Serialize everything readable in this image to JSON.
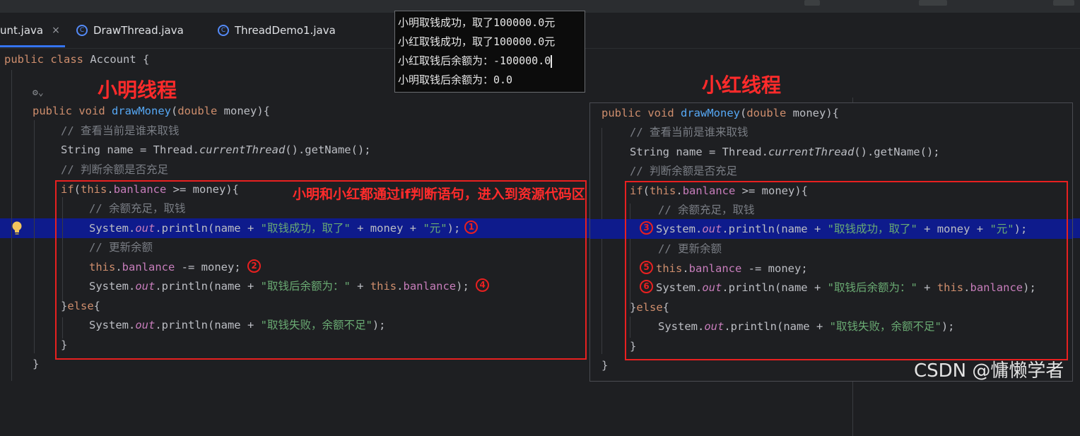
{
  "tabs": [
    {
      "label": "unt.java",
      "close": "×",
      "active": true
    },
    {
      "label": "DrawThread.java",
      "active": false
    },
    {
      "label": "ThreadDemo1.java",
      "active": false
    }
  ],
  "code": {
    "class_line": {
      "kw": "public class",
      "name": "Account",
      "brace": "{"
    },
    "left": {
      "method_kw": "public void",
      "method_name": "drawMoney",
      "param_open": "(",
      "param_type": "double",
      "param_rest": " money){",
      "cmt1": "// 查看当前是谁来取钱",
      "name_a": "String name = Thread.",
      "name_b": "currentThread",
      "name_c": "().getName();",
      "cmt2": "// 判断余额是否充足",
      "if_kw": "if",
      "if_open": "(",
      "this1": "this",
      "dot1": ".",
      "fld1": "banlance",
      "if_rest": " >= money){",
      "cmt3": "// 余额充足，取钱",
      "p1_a": "System.",
      "p1_out": "out",
      "p1_b": ".println(name + ",
      "p1_str1": "\"取钱成功，取了\"",
      "p1_c": " + money + ",
      "p1_str2": "\"元\"",
      "p1_d": ");",
      "cmt4": "// 更新余额",
      "sub_this": "this",
      "sub_dot": ".",
      "sub_fld": "banlance",
      "sub_rest": " -= money;",
      "p2_a": "System.",
      "p2_out": "out",
      "p2_b": ".println(name + ",
      "p2_str": "\"取钱后余额为：\"",
      "p2_c": " + ",
      "p2_this": "this",
      "p2_dot": ".",
      "p2_fld": "banlance",
      "p2_d": ");",
      "else_a": "}",
      "else_kw": "else",
      "else_b": "{",
      "p3_a": "System.",
      "p3_out": "out",
      "p3_b": ".println(name + ",
      "p3_str": "\"取钱失败，余额不足\"",
      "p3_c": ");",
      "close_if": "}",
      "close_method": "}"
    }
  },
  "annotations": {
    "left_title": "小明线程",
    "right_title": "小红线程",
    "middle_note": "小明和小红都通过if判断语句，进入到资源代码区",
    "step1": "1",
    "step2": "2",
    "step3": "3",
    "step4": "4",
    "step5": "5",
    "step6": "6"
  },
  "console": {
    "lines": [
      "小明取钱成功，取了100000.0元",
      "小红取钱成功，取了100000.0元",
      "小红取钱后余额为：-100000.0",
      "小明取钱后余额为：0.0"
    ]
  },
  "inlay_hint": "⚙⌄",
  "watermark": "CSDN @慵懒学者",
  "colors": {
    "keyword": "#cf8e6d",
    "function": "#56a8f5",
    "field": "#c77dbb",
    "string": "#6aab73",
    "comment": "#7a7e85",
    "highlight_row": "#0e1b8c",
    "annotation_red": "#e82020"
  }
}
